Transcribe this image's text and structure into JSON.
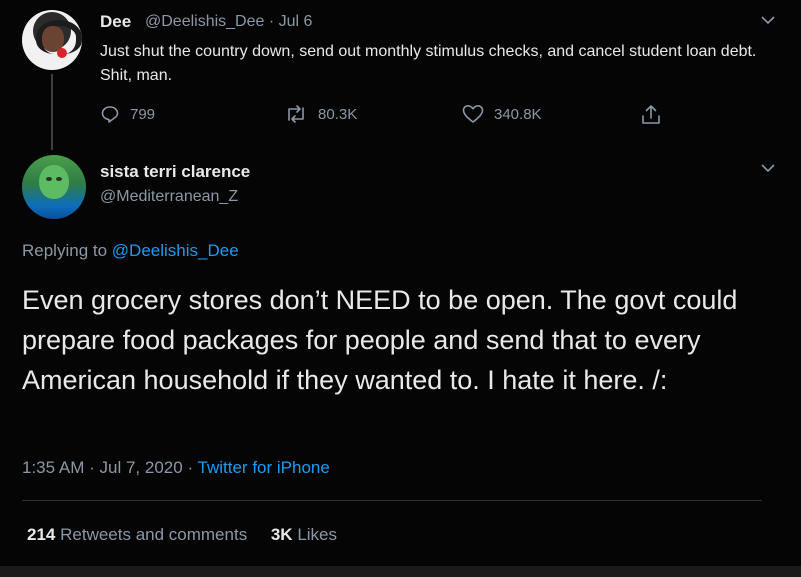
{
  "parent_tweet": {
    "display_name": "Dee",
    "handle": "@Deelishis_Dee",
    "separator": "·",
    "date": "Jul 6",
    "text": "Just shut the country down, send out monthly stimulus checks, and cancel student loan debt. Shit, man.",
    "replies": "799",
    "retweets": "80.3K",
    "likes": "340.8K"
  },
  "main_tweet": {
    "display_name": "sista terri clarence",
    "handle": "@Mediterranean_Z",
    "replying_label": "Replying to",
    "replying_to": "@Deelishis_Dee",
    "text": "Even grocery stores don’t NEED to be open. The govt could prepare food packages for people and send that to every American household if they wanted to. I hate it here. /:",
    "time": "1:35 AM",
    "date": "Jul 7, 2020",
    "source": "Twitter for iPhone",
    "retweets_count": "214",
    "retweets_label": "Retweets and comments",
    "likes_count": "3K",
    "likes_label": "Likes"
  },
  "icons": {
    "reply": "reply-icon",
    "retweet": "retweet-icon",
    "like": "heart-icon",
    "share": "share-icon",
    "more": "chevron-down-icon"
  },
  "colors": {
    "background": "#050505",
    "accent": "#1d9bf0",
    "muted": "#8b98a5"
  }
}
